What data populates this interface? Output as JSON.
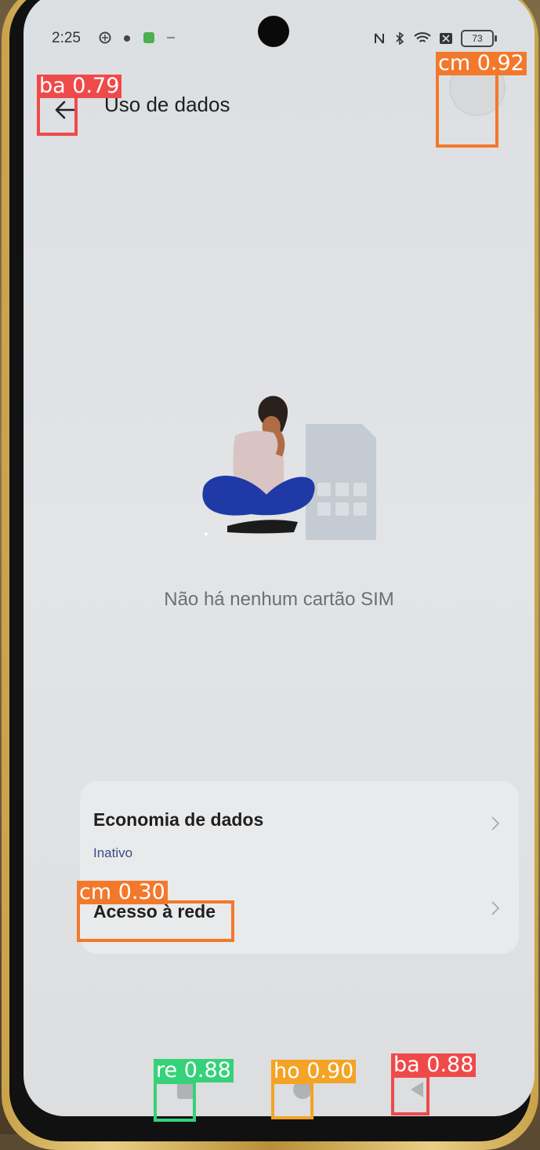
{
  "status_bar": {
    "time": "2:25",
    "battery": "73"
  },
  "header": {
    "title": "Uso de dados"
  },
  "empty_state": {
    "message": "Não há nenhum cartão SIM"
  },
  "settings": {
    "items": [
      {
        "title": "Economia de dados",
        "subtitle": "Inativo"
      },
      {
        "title": "Acesso à rede"
      }
    ]
  },
  "detections": [
    {
      "label": "ba 0.79"
    },
    {
      "label": "cm 0.92"
    },
    {
      "label": "cm 0.30"
    },
    {
      "label": "re 0.88"
    },
    {
      "label": "ho 0.90"
    },
    {
      "label": "ba 0.88"
    }
  ],
  "colors": {
    "back_detection": "#ef4a4a",
    "cm_detection": "#f2792c",
    "recent_detection": "#35d27a",
    "home_detection": "#f4a324",
    "subtitle_blue": "#3b4b8a"
  }
}
